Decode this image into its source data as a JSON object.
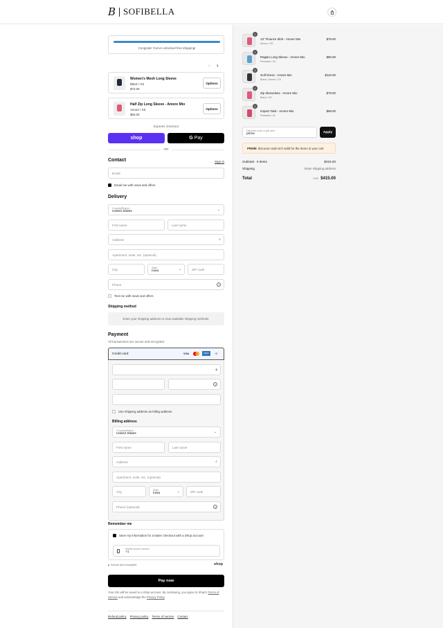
{
  "brand": {
    "mark": "B",
    "name": "SOFIBELLA"
  },
  "shipping_banner": {
    "text": "Congrats! You've unlocked free shipping!",
    "progress": 1.0
  },
  "upsells": [
    {
      "name": "Women's Mesh Long Sleeve",
      "variant": "Black / XS",
      "price": "$74.00",
      "button": "Options"
    },
    {
      "name": "Half Zip Long Sleeve - Amore Mio",
      "variant": "Amore / XS",
      "price": "$84.00",
      "button": "Options"
    }
  ],
  "express": {
    "label": "Express checkout",
    "shop_label": "shop",
    "gpay_label": "Pay",
    "or": "OR"
  },
  "contact": {
    "title": "Contact",
    "sign_in": "Sign in",
    "email_placeholder": "Email",
    "news_label": "Email me with news and offers"
  },
  "delivery": {
    "title": "Delivery",
    "country_label": "Country/Region",
    "country_value": "United States",
    "first_name": "First name",
    "last_name": "Last name",
    "address": "Address",
    "apartment": "Apartment, suite, etc. (optional)",
    "city": "City",
    "state_label": "State",
    "state_value": "Iowa",
    "zip": "ZIP code",
    "phone": "Phone",
    "text_label": "Text me with news and offers"
  },
  "shipping_method": {
    "title": "Shipping method",
    "note": "Enter your shipping address to view available shipping methods."
  },
  "payment": {
    "title": "Payment",
    "subtitle": "All transactions are secure and encrypted.",
    "method": "Credit card",
    "cards": [
      "VISA",
      "MC",
      "AMEX",
      "+5"
    ],
    "same_address": "Use shipping address as billing address",
    "billing_title": "Billing address",
    "country_label": "Country/Region",
    "country_value": "United States",
    "first_name": "First name",
    "last_name": "Last name",
    "address": "Address",
    "apartment": "Apartment, suite, etc. (optional)",
    "city": "City",
    "state_label": "State",
    "state_value": "Iowa",
    "zip": "ZIP code",
    "phone": "Phone (optional)"
  },
  "remember": {
    "title": "Remember me",
    "save_label": "Save my information for a faster checkout with a Shop account",
    "mobile_label": "Mobile phone number",
    "mobile_value": "+1",
    "secure": "Secure and encrypted",
    "shop": "shop"
  },
  "pay_button": "Pay now",
  "legal": {
    "part1": "Your info will be saved to a Shop account. By continuing, you agree to Shop's",
    "terms": "Terms of Service",
    "part2": "and acknowledge the",
    "privacy": "Privacy Policy",
    "end": "."
  },
  "footer_links": [
    "Refund policy",
    "Privacy policy",
    "Terms of service",
    "Contact"
  ],
  "cart": [
    {
      "qty": "1",
      "name": "13\" Flounce Skirt - Amore Mio",
      "variant": "Amore / XS",
      "price": "$78.00",
      "color": "#e0587a"
    },
    {
      "qty": "1",
      "name": "Raglan Long Sleeve - Amore Mio",
      "variant": "Pinkstest / XS",
      "price": "$80.00",
      "color": "#5aa0d0"
    },
    {
      "qty": "1",
      "name": "Golf Dress - Amore Mio",
      "variant": "Black / Amore / XS",
      "price": "$110.00",
      "color": "#333333"
    },
    {
      "qty": "1",
      "name": "Zip Sleeveless - Amore Mio",
      "variant": "Black / XS",
      "price": "$79.00",
      "color": "#e0587a"
    },
    {
      "qty": "1",
      "name": "Impact Tank - Amore Mio",
      "variant": "Pinkstest / XL",
      "price": "$68.00",
      "color": "#d44a6c"
    }
  ],
  "discount": {
    "label": "Discount code or gift card",
    "value": "prime",
    "apply": "Apply",
    "error_code": "PRIME",
    "error_text": "discount code isn't valid for the items in your cart"
  },
  "summary": {
    "subtotal_label": "Subtotal · 5 items",
    "subtotal": "$415.00",
    "shipping_label": "Shipping",
    "shipping_value": "Enter shipping address",
    "total_label": "Total",
    "currency": "USD",
    "total": "$415.00"
  }
}
